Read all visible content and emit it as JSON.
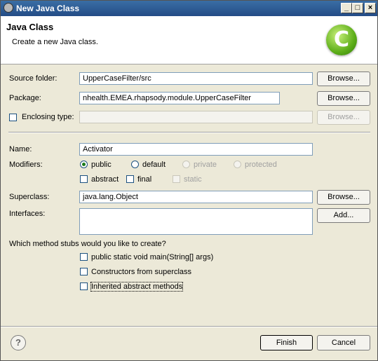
{
  "window": {
    "title": "New Java Class",
    "min_label": "_",
    "max_label": "□",
    "close_label": "×"
  },
  "header": {
    "title": "Java Class",
    "subtitle": "Create a new Java class.",
    "logo_letter": "C"
  },
  "form": {
    "source_folder_label": "Source folder:",
    "source_folder_value": "UpperCaseFilter/src",
    "package_label": "Package:",
    "package_value": "nhealth.EMEA.rhapsody.module.UpperCaseFilter",
    "enclosing_type_label": "Enclosing type:",
    "enclosing_type_value": "",
    "name_label": "Name:",
    "name_value": "Activator",
    "modifiers_label": "Modifiers:",
    "modifiers": {
      "public": "public",
      "default": "default",
      "private": "private",
      "protected": "protected",
      "abstract": "abstract",
      "final": "final",
      "static": "static"
    },
    "superclass_label": "Superclass:",
    "superclass_value": "java.lang.Object",
    "interfaces_label": "Interfaces:",
    "stubs_question": "Which method stubs would you like to create?",
    "stub_main": "public static void main(String[] args)",
    "stub_constructors": "Constructors from superclass",
    "stub_inherited": "Inherited abstract methods"
  },
  "buttons": {
    "browse": "Browse...",
    "add": "Add...",
    "finish": "Finish",
    "cancel": "Cancel",
    "help": "?"
  }
}
